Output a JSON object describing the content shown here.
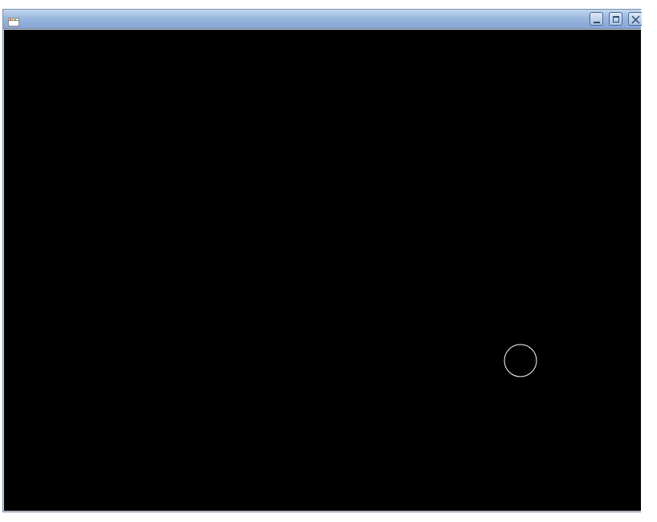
{
  "window": {
    "title": "",
    "icon": "app-window-icon",
    "controls": {
      "minimize": "minimize-icon",
      "maximize": "maximize-icon",
      "close": "close-icon"
    },
    "colors": {
      "titlebar": "#9ab7de",
      "canvas_background": "#000000",
      "shape_stroke": "#ffffff"
    }
  },
  "canvas": {
    "shapes": [
      {
        "type": "circle",
        "fill": "none",
        "stroke": "#ffffff"
      }
    ]
  }
}
